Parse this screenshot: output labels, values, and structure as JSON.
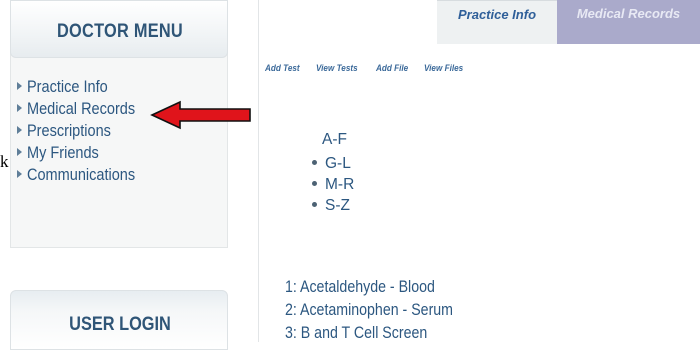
{
  "doctor_menu": {
    "title": "DOCTOR MENU",
    "items": [
      {
        "label": "Practice Info"
      },
      {
        "label": "Medical Records"
      },
      {
        "label": "Prescriptions"
      },
      {
        "label": "My Friends"
      },
      {
        "label": "Communications"
      }
    ]
  },
  "stray_text": "k",
  "user_login": {
    "title": "USER LOGIN"
  },
  "tabs": [
    {
      "label": "Practice Info"
    },
    {
      "label": "Medical Records"
    }
  ],
  "subnav": [
    "Add Test",
    "View Tests",
    "Add File",
    "View Files"
  ],
  "alphabet": {
    "first": "A-F",
    "items": [
      "G-L",
      "M-R",
      "S-Z"
    ]
  },
  "results": [
    "1: Acetaldehyde - Blood",
    "2: Acetaminophen - Serum",
    "3: B and T Cell Screen"
  ],
  "colors": {
    "arrow": "#e0141b",
    "tab_active": "#aaaacb",
    "link": "#2c5780"
  }
}
